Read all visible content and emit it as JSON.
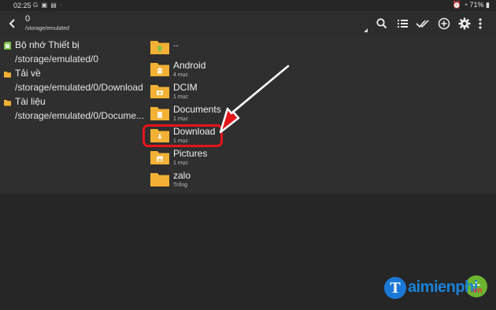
{
  "status_bar": {
    "time": "02:25",
    "icons": "G ▣ ▤ ·",
    "battery": "71%"
  },
  "toolbar": {
    "back_icon": "arrow-left-icon",
    "title": "0",
    "subtitle": "/storage/emulated",
    "actions": [
      "search-icon",
      "list-view-icon",
      "multi-select-icon",
      "add-icon",
      "settings-icon",
      "more-vert-icon"
    ]
  },
  "bookmarks": [
    {
      "name": "Bộ nhớ Thiết bị",
      "path": "/storage/emulated/0",
      "icon": "sd-card-icon"
    },
    {
      "name": "Tải về",
      "path": "/storage/emulated/0/Download",
      "icon": "folder-icon"
    },
    {
      "name": "Tài liệu",
      "path": "/storage/emulated/0/Docume...",
      "icon": "folder-icon"
    }
  ],
  "files": [
    {
      "name": "..",
      "meta": "",
      "badge": "up-arrow-icon"
    },
    {
      "name": "Android",
      "meta": "4 mục",
      "badge": "android-icon"
    },
    {
      "name": "DCIM",
      "meta": "1 mục",
      "badge": "camera-icon"
    },
    {
      "name": "Documents",
      "meta": "1 mục",
      "badge": "document-icon"
    },
    {
      "name": "Download",
      "meta": "1 mục",
      "badge": "download-icon"
    },
    {
      "name": "Pictures",
      "meta": "1 mục",
      "badge": "image-icon"
    },
    {
      "name": "zalo",
      "meta": "Trống",
      "badge": ""
    }
  ],
  "fab_label": "+",
  "watermark": {
    "text": "aimienphi",
    "suffix": ".vn",
    "logo_letter": "T"
  },
  "colors": {
    "folder": "#f2b134",
    "highlight": "#e5151a",
    "fab": "#6bb532",
    "accent": "#1a82d9"
  }
}
